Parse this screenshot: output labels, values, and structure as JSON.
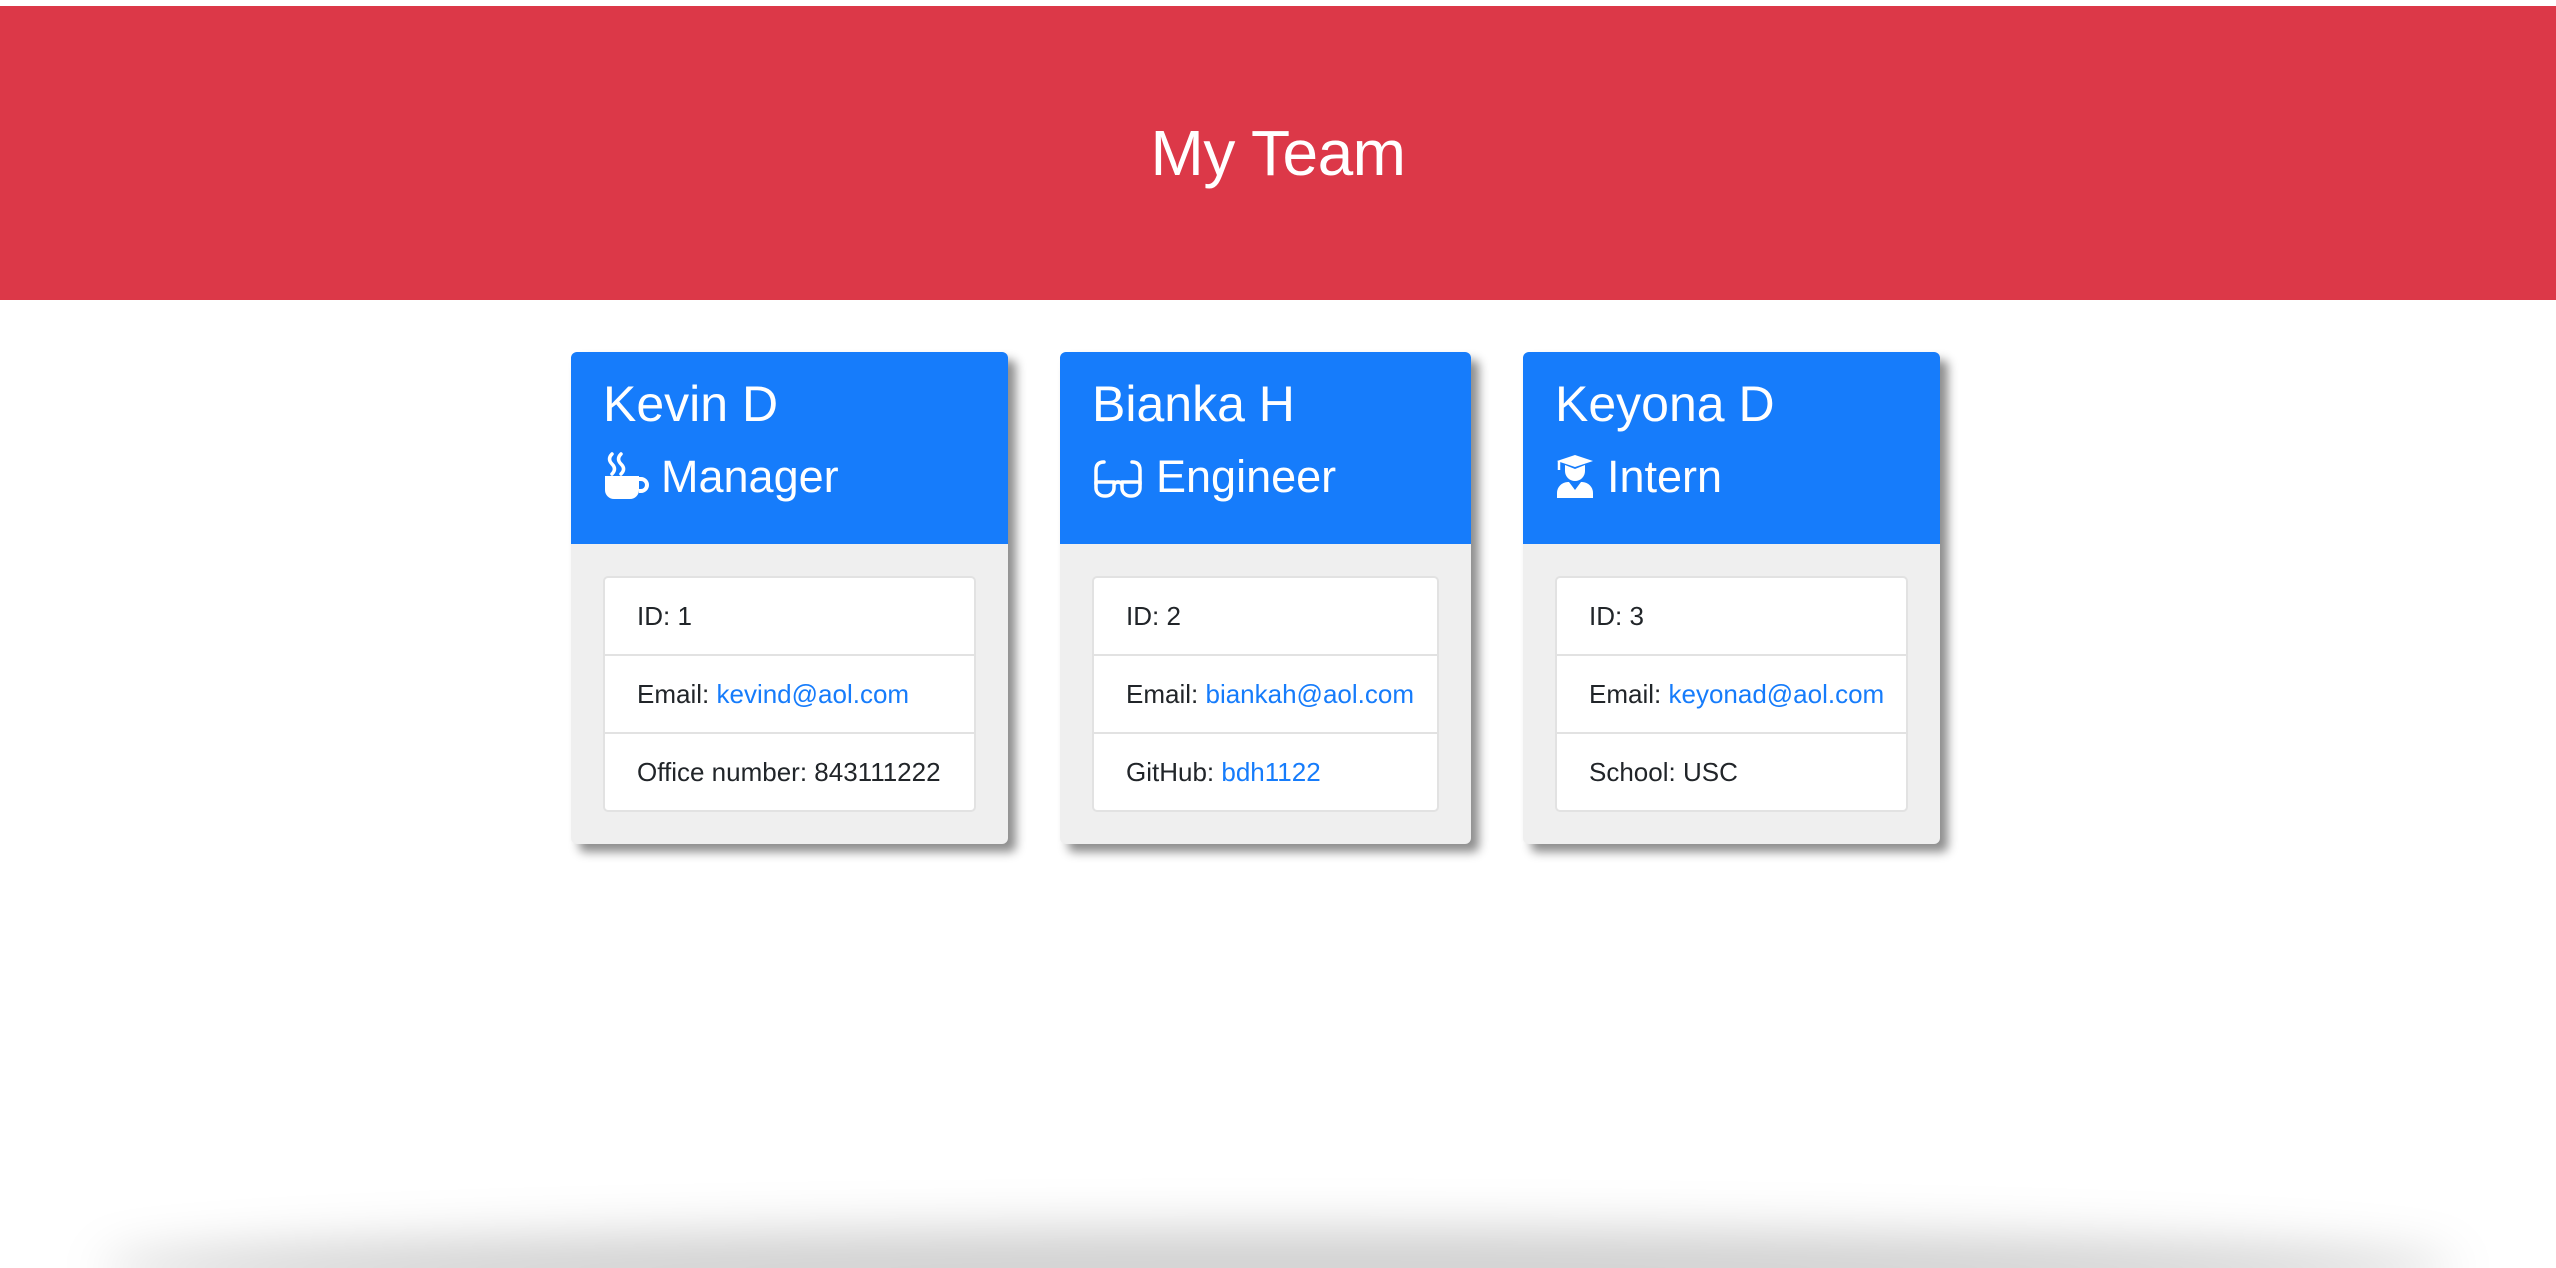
{
  "header": {
    "title": "My Team",
    "bg_color": "#dc3848"
  },
  "accent_color": "#167cfb",
  "team": [
    {
      "name": "Kevin D",
      "role": "Manager",
      "icon": "mug-icon",
      "id_label": "ID:",
      "id": "1",
      "email_label": "Email:",
      "email": "kevind@aol.com",
      "extra_label": "Office number:",
      "extra_value": "843111222"
    },
    {
      "name": "Bianka H",
      "role": "Engineer",
      "icon": "glasses-icon",
      "id_label": "ID:",
      "id": "2",
      "email_label": "Email:",
      "email": "biankah@aol.com",
      "extra_label": "GitHub:",
      "extra_value": "bdh1122"
    },
    {
      "name": "Keyona D",
      "role": "Intern",
      "icon": "graduate-icon",
      "id_label": "ID:",
      "id": "3",
      "email_label": "Email:",
      "email": "keyonad@aol.com",
      "extra_label": "School:",
      "extra_value": "USC"
    }
  ]
}
